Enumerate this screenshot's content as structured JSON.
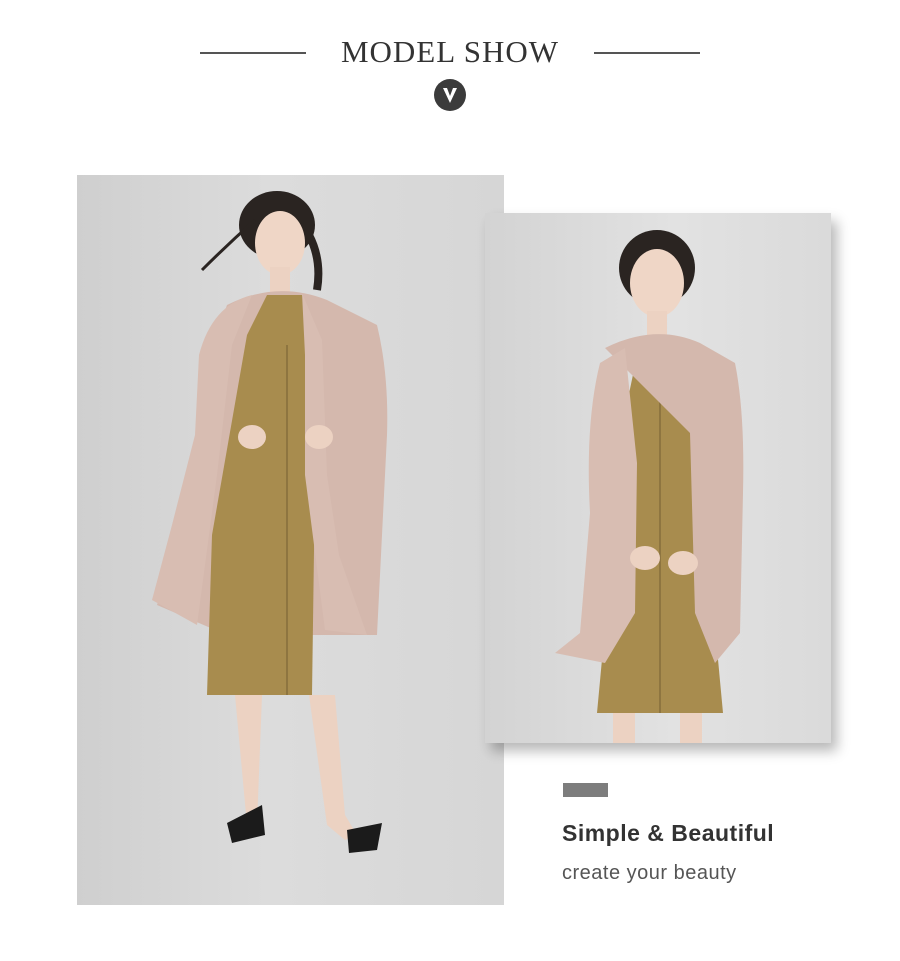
{
  "header": {
    "title": "MODEL SHOW",
    "badge_icon": "chevron-down-icon"
  },
  "caption": {
    "heading": "Simple & Beautiful",
    "subheading": "create your beauty"
  },
  "colors": {
    "background": "#ffffff",
    "text_dark": "#333333",
    "cardigan": "#d4b8ad",
    "dress": "#a88c4e",
    "badge": "#3b3b3b",
    "accent_bar": "#7d7d7d"
  }
}
